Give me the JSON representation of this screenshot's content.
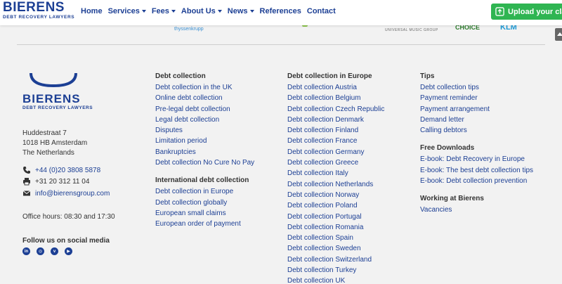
{
  "header": {
    "logo_main": "BIERENS",
    "logo_sub": "DEBT RECOVERY LAWYERS",
    "nav": [
      {
        "label": "Home",
        "dropdown": false
      },
      {
        "label": "Services",
        "dropdown": true
      },
      {
        "label": "Fees",
        "dropdown": true
      },
      {
        "label": "About Us",
        "dropdown": true
      },
      {
        "label": "News",
        "dropdown": true
      },
      {
        "label": "References",
        "dropdown": false
      },
      {
        "label": "Contact",
        "dropdown": false
      }
    ],
    "upload_label": "Upload your clai",
    "upload_icon": "upload-icon"
  },
  "strip": {
    "logo1": "thyssenkrupp",
    "logo2": "UNIVERSAL MUSIC GROUP",
    "logo3": "CHOICE",
    "logo4": "KLM"
  },
  "footer": {
    "brand_main": "BIERENS",
    "brand_sub": "DEBT RECOVERY LAWYERS",
    "address": [
      "Huddestraat 7",
      "1018 HB Amsterdam",
      "The Netherlands"
    ],
    "phone": "+44 (0)20 3808 5878",
    "fax": "+31 20 312 11 04",
    "email": "info@bierensgroup.com",
    "hours": "Office hours: 08:30 and 17:30",
    "social_title": "Follow us on social media",
    "social": [
      "linkedin-icon",
      "instagram-icon",
      "vimeo-icon",
      "youtube-icon"
    ],
    "columns": {
      "debt_collection": {
        "title": "Debt collection",
        "links": [
          "Debt collection in the UK",
          "Online debt collection",
          "Pre-legal debt collection",
          "Legal debt collection",
          "Disputes",
          "Limitation period",
          "Bankruptcies",
          "Debt collection No Cure No Pay"
        ]
      },
      "international": {
        "title": "International debt collection",
        "links": [
          "Debt collection in Europe",
          "Debt collection globally",
          "European small claims",
          "European order of payment"
        ]
      },
      "europe": {
        "title": "Debt collection in Europe",
        "links": [
          "Debt collection Austria",
          "Debt collection Belgium",
          "Debt collection Czech Republic",
          "Debt collection Denmark",
          "Debt collection Finland",
          "Debt collection France",
          "Debt collection Germany",
          "Debt collection Greece",
          "Debt collection Italy",
          "Debt collection Netherlands",
          "Debt collection Norway",
          "Debt collection Poland",
          "Debt collection Portugal",
          "Debt collection Romania",
          "Debt collection Spain",
          "Debt collection Sweden",
          "Debt collection Switzerland",
          "Debt collection Turkey",
          "Debt collection UK"
        ]
      },
      "tips": {
        "title": "Tips",
        "links": [
          "Debt collection tips",
          "Payment reminder",
          "Payment arrangement",
          "Demand letter",
          "Calling debtors"
        ]
      },
      "downloads": {
        "title": "Free Downloads",
        "links": [
          "E-book: Debt Recovery in Europe",
          "E-book: The best debt collection tips",
          "E-book: Debt collection prevention"
        ]
      },
      "working": {
        "title": "Working at Bierens",
        "links": [
          "Vacancies"
        ]
      }
    }
  }
}
